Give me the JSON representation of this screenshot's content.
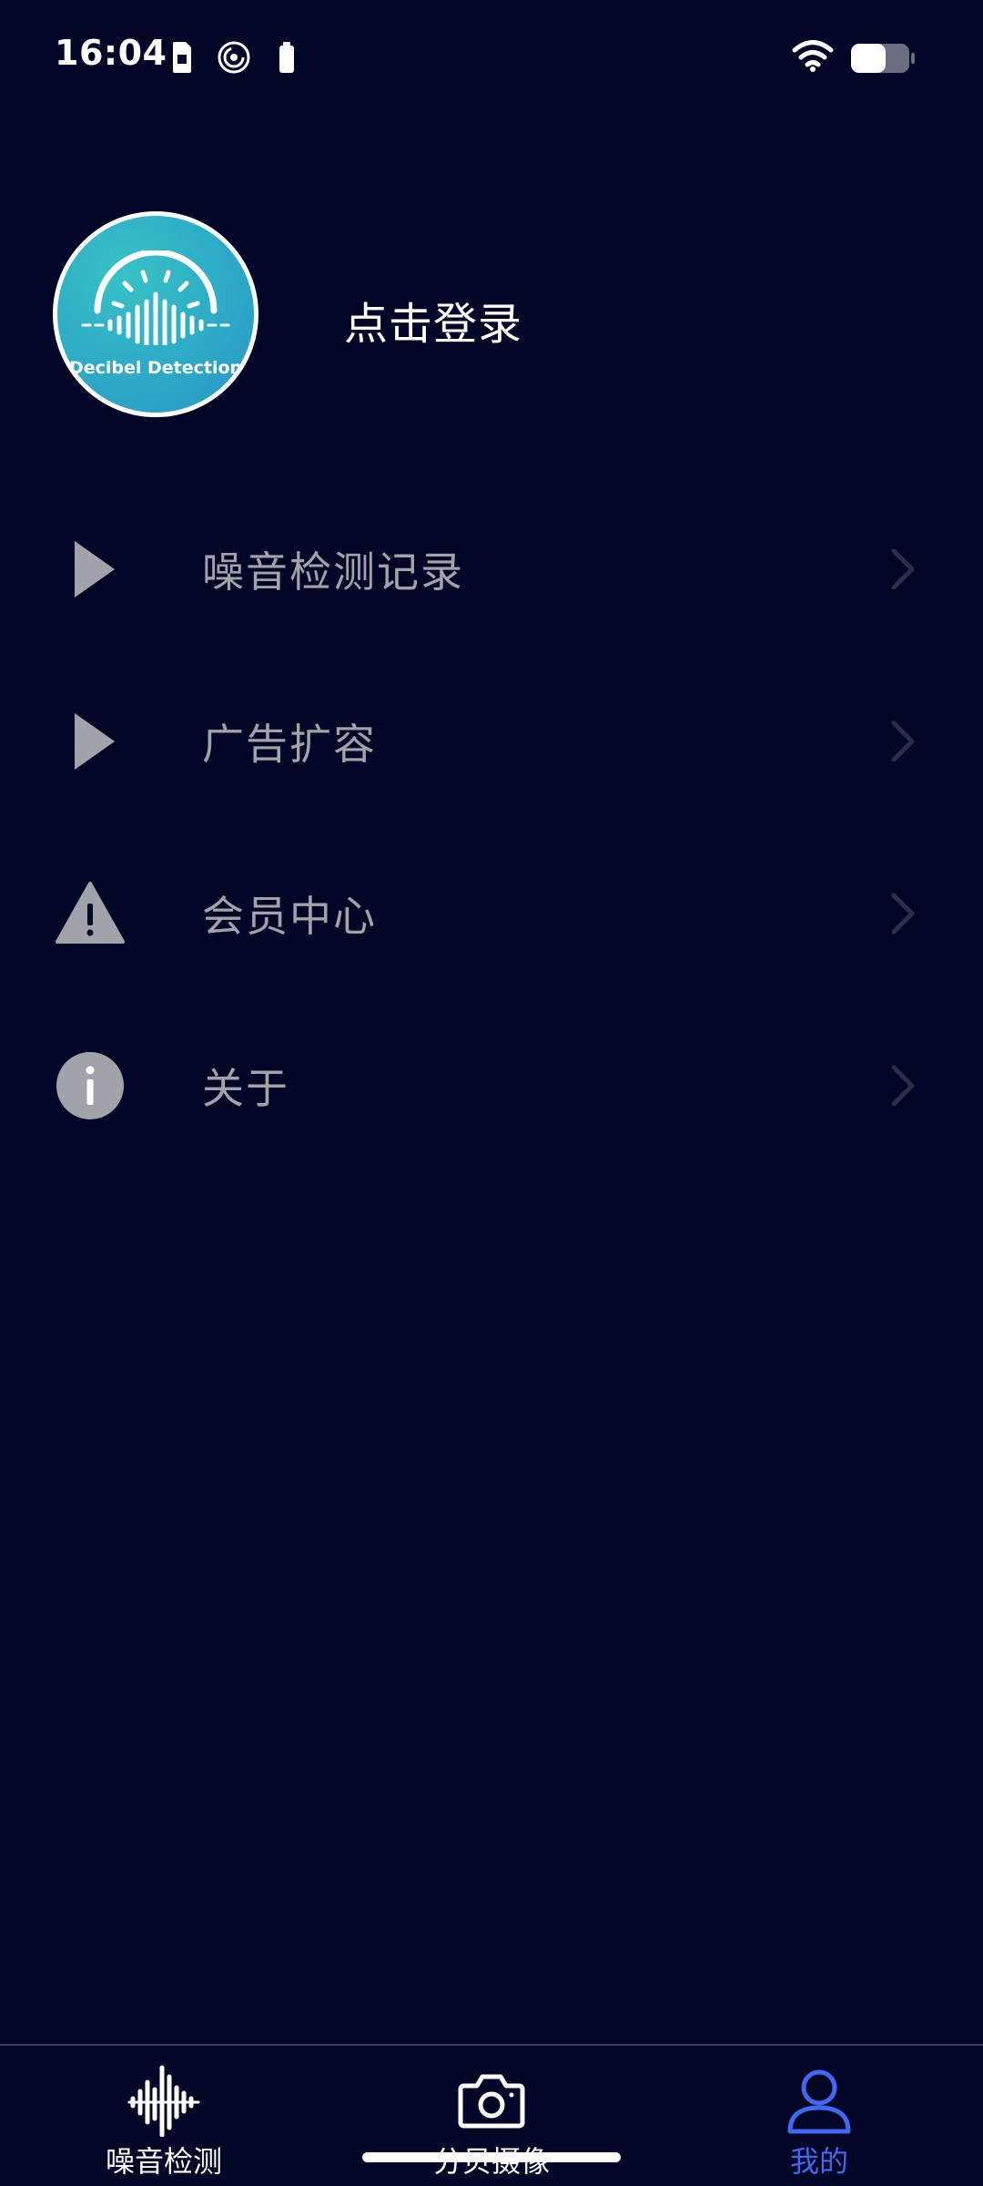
{
  "status_bar": {
    "time": "16:04",
    "icons": [
      "sim-card-icon",
      "data-saver-icon",
      "battery-small-icon",
      "wifi-icon",
      "battery-icon"
    ],
    "battery_level": 0.6
  },
  "profile": {
    "avatar_caption": "Decibel Detection",
    "login_label": "点击登录"
  },
  "menu": {
    "items": [
      {
        "label": "噪音检测记录",
        "icon": "play-triangle-icon"
      },
      {
        "label": "广告扩容",
        "icon": "play-triangle-icon"
      },
      {
        "label": "会员中心",
        "icon": "warning-icon"
      },
      {
        "label": "关于",
        "icon": "info-icon"
      }
    ]
  },
  "bottom_nav": {
    "items": [
      {
        "label": "噪音检测",
        "icon": "sound-wave-icon",
        "active": false
      },
      {
        "label": "分贝摄像",
        "icon": "camera-icon",
        "active": false
      },
      {
        "label": "我的",
        "icon": "user-icon",
        "active": true
      }
    ]
  },
  "colors": {
    "background": "#020626",
    "menu_text": "#a2a2aa",
    "active_tab": "#3f69ef",
    "avatar_teal": "#2eaec6"
  }
}
